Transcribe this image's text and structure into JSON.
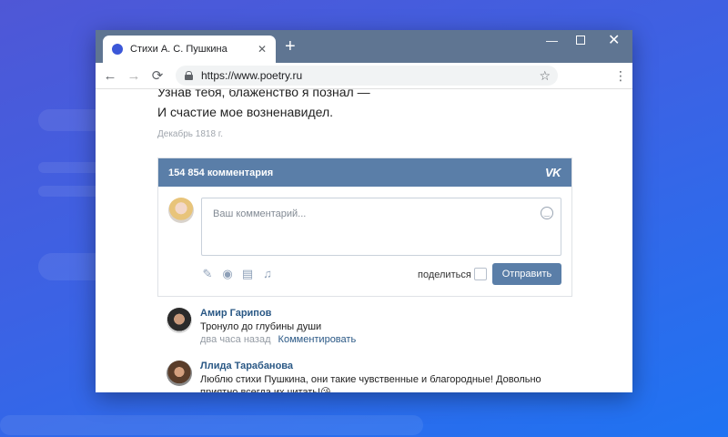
{
  "browser": {
    "tab_title": "Стихи А. С. Пушкина",
    "tab_close": "✕",
    "new_tab": "+",
    "url": "https://www.poetry.ru",
    "controls": {
      "minimize": "—",
      "close": "✕"
    }
  },
  "poem": {
    "lines": [
      "Узнав тебя, блаженство я познал —",
      "И счастие мое возненавидел."
    ],
    "date": "Декабрь 1818 г."
  },
  "widget": {
    "count_label": "154 854 комментария",
    "logo": "VK",
    "placeholder": "Ваш комментарий...",
    "share_label": "поделиться",
    "send_label": "Отправить"
  },
  "comments": [
    {
      "author": "Амир Гарипов",
      "text": "Тронуло до глубины души",
      "time": "два часа назад",
      "reply": "Комментировать"
    },
    {
      "author": "Ллида Тарабанова",
      "text": "Люблю стихи Пушкина, они такие чувственные и благородные! Довольно приятно всегда их читать!😘"
    }
  ],
  "colors": {
    "vk_blue": "#5a7ea8",
    "link": "#2a5885",
    "browser_frame": "#5f7592"
  }
}
